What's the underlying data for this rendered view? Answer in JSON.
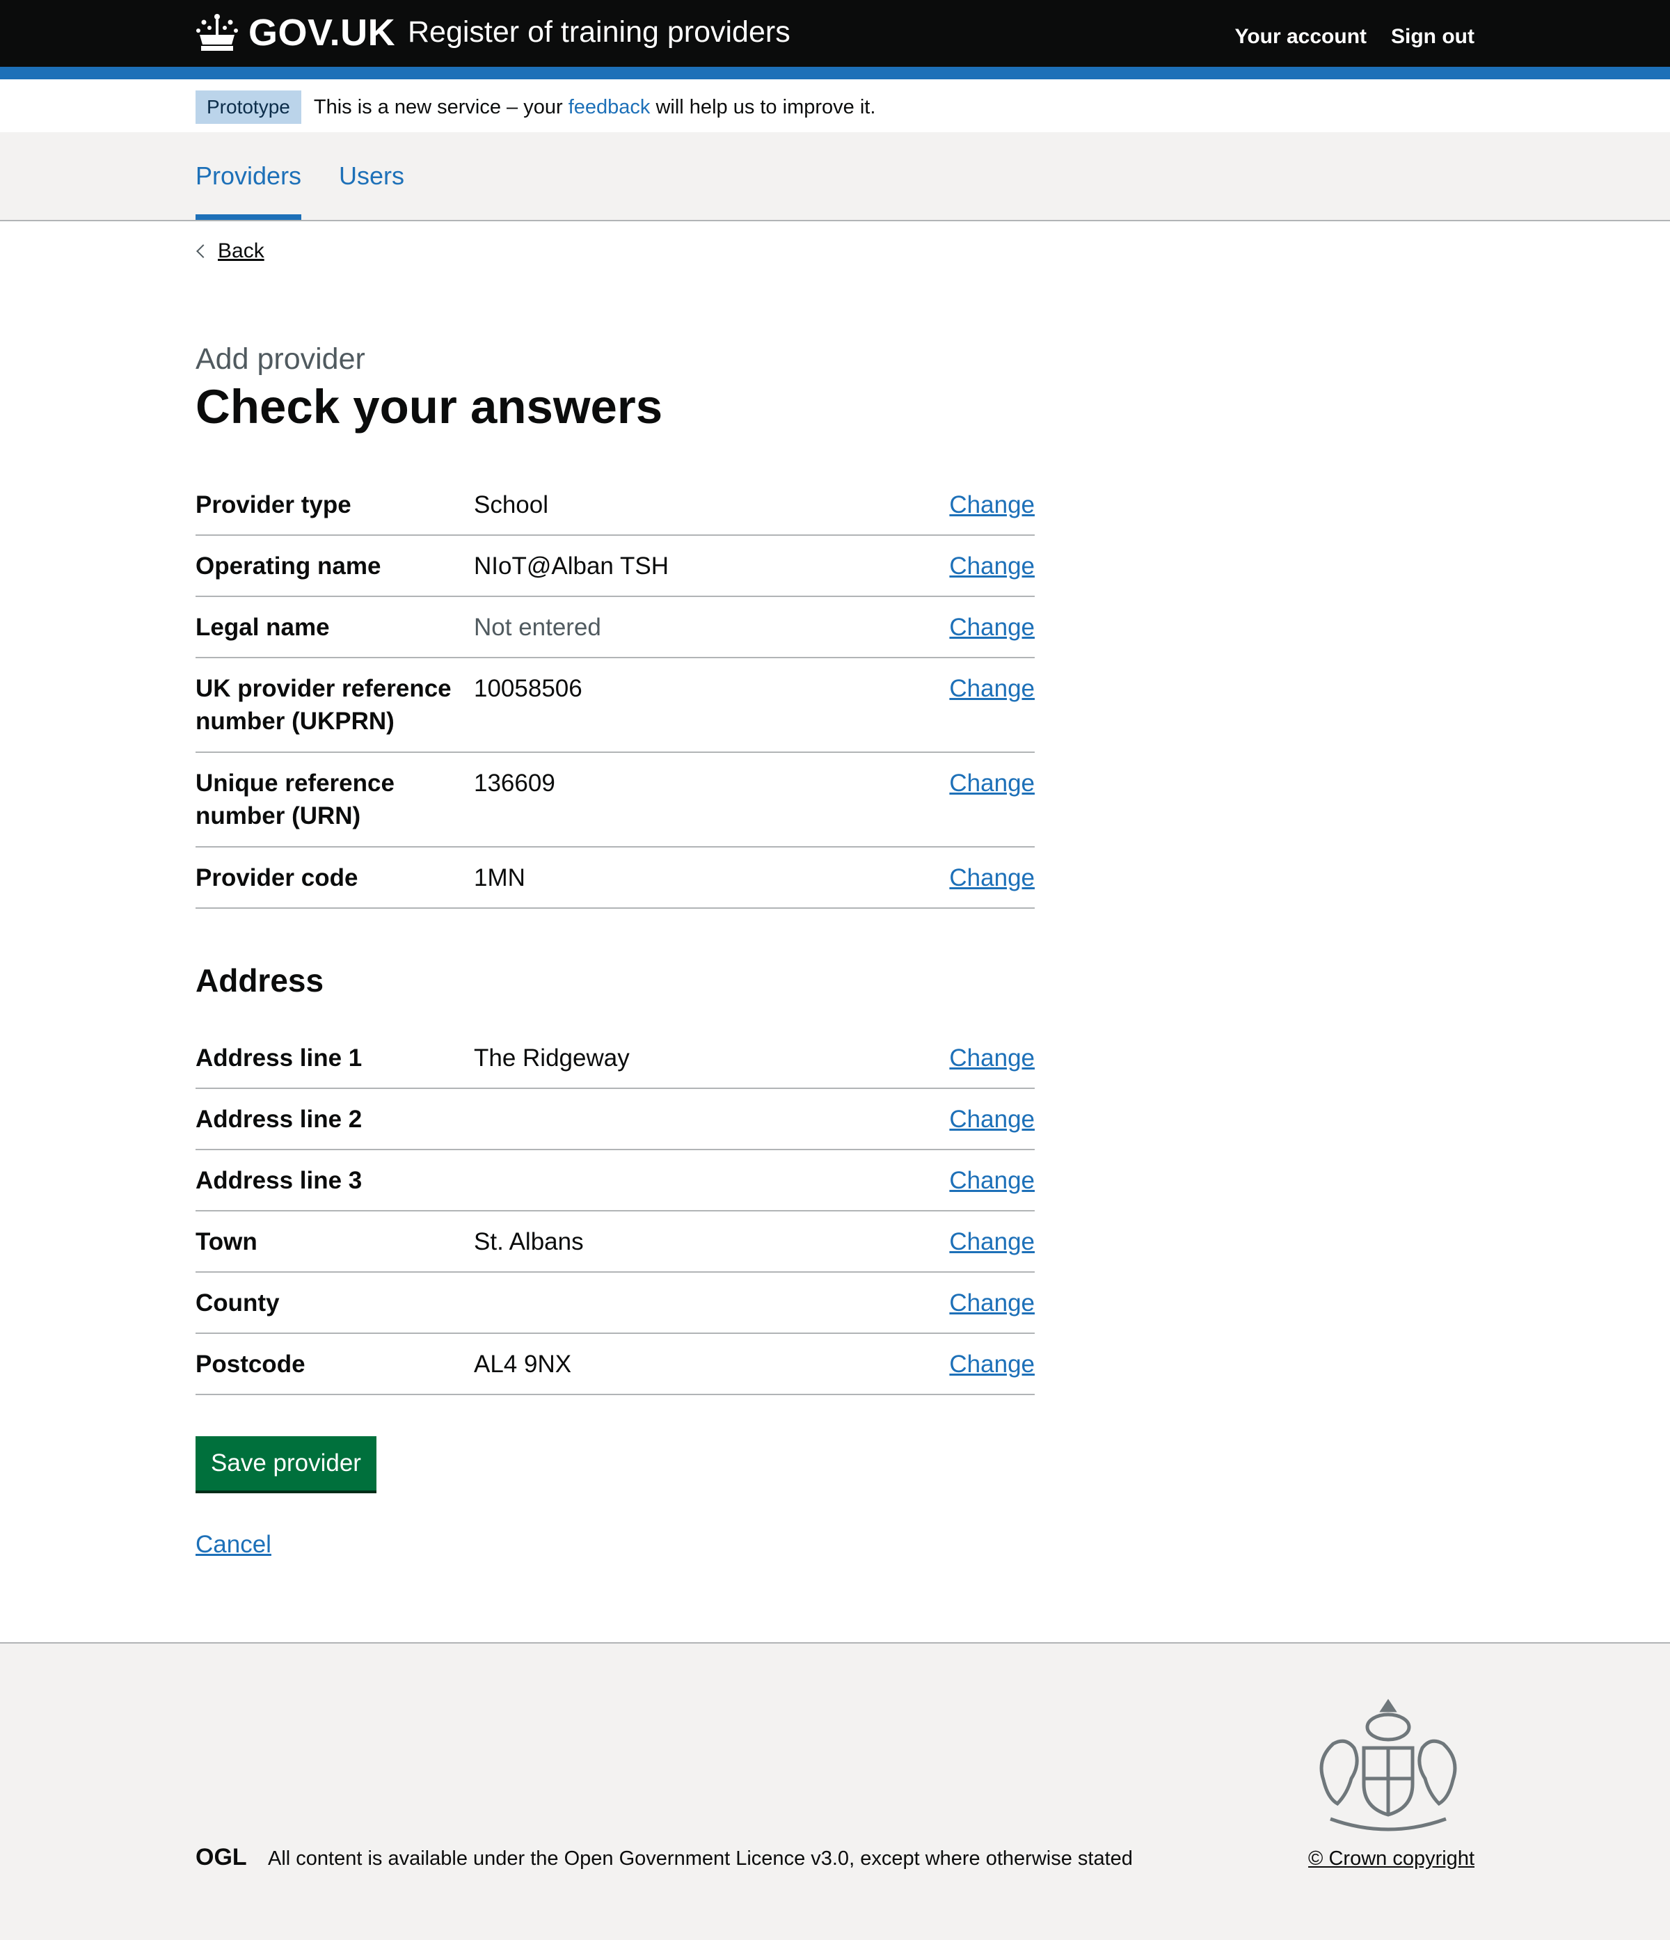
{
  "header": {
    "logo_text": "GOV.UK",
    "service_name": "Register of training providers",
    "nav": [
      "Your account",
      "Sign out"
    ]
  },
  "phase_banner": {
    "tag": "Prototype",
    "text_before": "This is a new service – your ",
    "link": "feedback",
    "text_after": " will help us to improve it."
  },
  "primary_nav": [
    {
      "label": "Providers",
      "active": true
    },
    {
      "label": "Users",
      "active": false
    }
  ],
  "back_link": "Back",
  "caption": "Add provider",
  "title": "Check your answers",
  "provider_rows": [
    {
      "key": "Provider type",
      "value": "School",
      "action": "Change"
    },
    {
      "key": "Operating name",
      "value": "NIoT@Alban TSH",
      "action": "Change"
    },
    {
      "key": "Legal name",
      "value": "Not entered",
      "action": "Change"
    },
    {
      "key": "UK provider reference number (UKPRN)",
      "value": "10058506",
      "action": "Change"
    },
    {
      "key": "Unique reference number (URN)",
      "value": "136609",
      "action": "Change"
    },
    {
      "key": "Provider code",
      "value": "1MN",
      "action": "Change"
    }
  ],
  "address_heading": "Address",
  "address_rows": [
    {
      "key": "Address line 1",
      "value": "The Ridgeway",
      "action": "Change"
    },
    {
      "key": "Address line 2",
      "value": "",
      "action": "Change"
    },
    {
      "key": "Address line 3",
      "value": "",
      "action": "Change"
    },
    {
      "key": "Town",
      "value": "St. Albans",
      "action": "Change"
    },
    {
      "key": "County",
      "value": "",
      "action": "Change"
    },
    {
      "key": "Postcode",
      "value": "AL4 9NX",
      "action": "Change"
    }
  ],
  "save_button": "Save provider",
  "cancel_link": "Cancel",
  "footer": {
    "ogl_text": "OGL",
    "licence_before": "All content is available under the ",
    "licence_link": "Open Government Licence v3.0",
    "licence_after": ", except where otherwise stated",
    "copyright": "© Crown copyright"
  }
}
